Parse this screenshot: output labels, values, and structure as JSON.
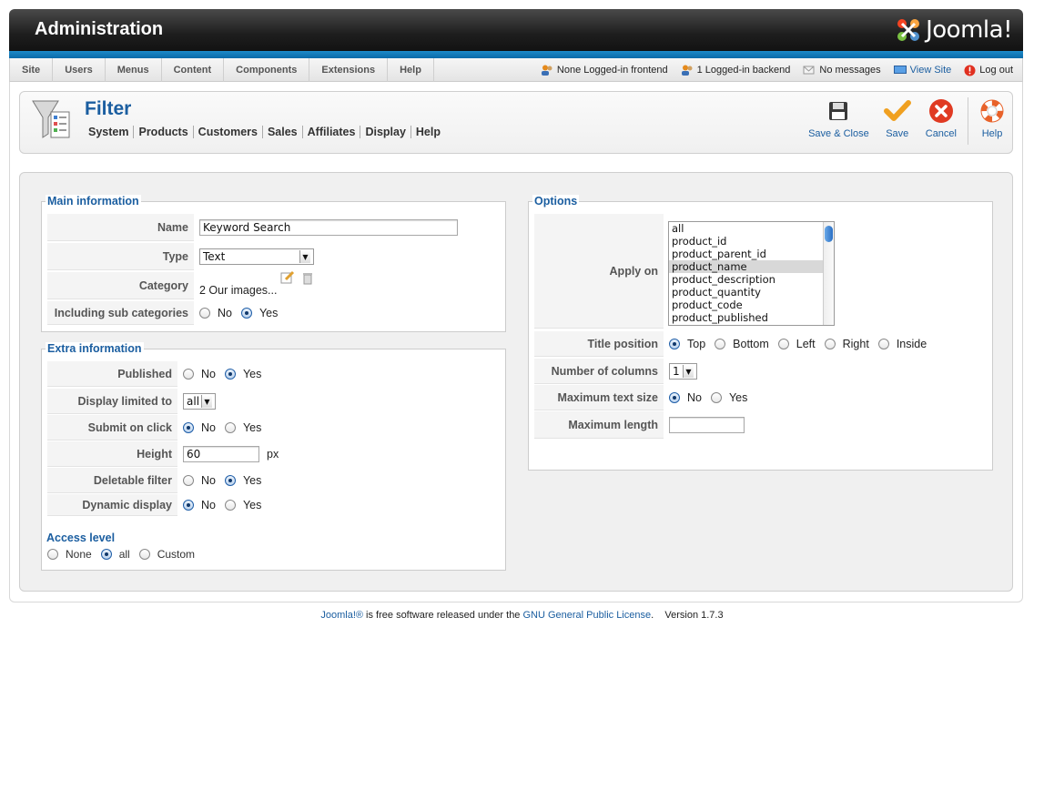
{
  "header": {
    "title": "Administration",
    "logo_text": "Joomla!"
  },
  "menu": {
    "items": [
      {
        "label": "Site"
      },
      {
        "label": "Users"
      },
      {
        "label": "Menus"
      },
      {
        "label": "Content"
      },
      {
        "label": "Components"
      },
      {
        "label": "Extensions"
      },
      {
        "label": "Help"
      }
    ],
    "status": {
      "frontend": "None Logged-in frontend",
      "backend": "1 Logged-in backend",
      "messages": "No messages",
      "view_site": "View Site",
      "logout": "Log out"
    }
  },
  "toolbar": {
    "title": "Filter",
    "submenu": [
      "System",
      "Products",
      "Customers",
      "Sales",
      "Affiliates",
      "Display",
      "Help"
    ],
    "save_close": "Save & Close",
    "save": "Save",
    "cancel": "Cancel",
    "help": "Help"
  },
  "main_info": {
    "legend": "Main information",
    "name_label": "Name",
    "name_value": "Keyword Search",
    "type_label": "Type",
    "type_value": "Text",
    "category_label": "Category",
    "category_value": "2 Our images...",
    "subcat_label": "Including sub categories",
    "subcat_no": "No",
    "subcat_yes": "Yes"
  },
  "extra_info": {
    "legend": "Extra information",
    "published_label": "Published",
    "display_limited_label": "Display limited to",
    "display_limited_value": "all",
    "submit_label": "Submit on click",
    "height_label": "Height",
    "height_value": "60",
    "height_unit": "px",
    "deletable_label": "Deletable filter",
    "dynamic_label": "Dynamic display",
    "no": "No",
    "yes": "Yes",
    "access_legend": "Access level",
    "access_none": "None",
    "access_all": "all",
    "access_custom": "Custom"
  },
  "options": {
    "legend": "Options",
    "apply_on_label": "Apply on",
    "apply_on_options": [
      "all",
      "product_id",
      "product_parent_id",
      "product_name",
      "product_description",
      "product_quantity",
      "product_code",
      "product_published"
    ],
    "apply_on_selected": "product_name",
    "title_position_label": "Title position",
    "title_positions": [
      "Top",
      "Bottom",
      "Left",
      "Right",
      "Inside"
    ],
    "title_position_selected": "Top",
    "columns_label": "Number of columns",
    "columns_value": "1",
    "max_text_label": "Maximum text size",
    "max_text_no": "No",
    "max_text_yes": "Yes",
    "max_length_label": "Maximum length",
    "max_length_value": ""
  },
  "footer": {
    "joomla_link": "Joomla!®",
    "text": " is free software released under the ",
    "license_link": "GNU General Public License",
    "version": "Version 1.7.3"
  },
  "colors": {
    "accent": "#1b5ea0",
    "header_dark": "#1e1e1e",
    "header_strip": "#0b6aa8"
  }
}
